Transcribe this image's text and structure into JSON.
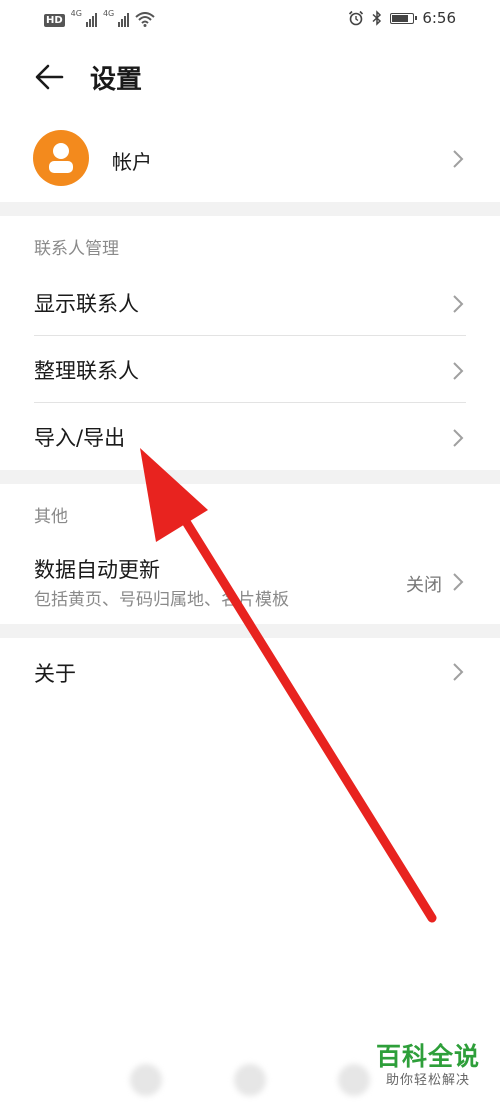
{
  "status_bar": {
    "left_badge": "HD",
    "network_1": "4G",
    "network_2": "4G",
    "time": "6:56",
    "battery_level": 0.85
  },
  "header": {
    "title": "设置"
  },
  "account": {
    "label": "帐户"
  },
  "contacts_section": {
    "header": "联系人管理",
    "items": [
      {
        "label": "显示联系人"
      },
      {
        "label": "整理联系人"
      },
      {
        "label": "导入/导出"
      }
    ]
  },
  "other_section": {
    "header": "其他",
    "auto_update": {
      "label": "数据自动更新",
      "subtitle": "包括黄页、号码归属地、名片模板",
      "value": "关闭"
    }
  },
  "about": {
    "label": "关于"
  },
  "watermark": {
    "main": "百科全说",
    "sub": "助你轻松解决"
  },
  "colors": {
    "avatar_bg": "#f38a1d",
    "annotation_arrow": "#e8231f",
    "watermark_green": "#2e9f3a"
  },
  "annotation": {
    "type": "arrow",
    "points_to": "导入/导出"
  }
}
